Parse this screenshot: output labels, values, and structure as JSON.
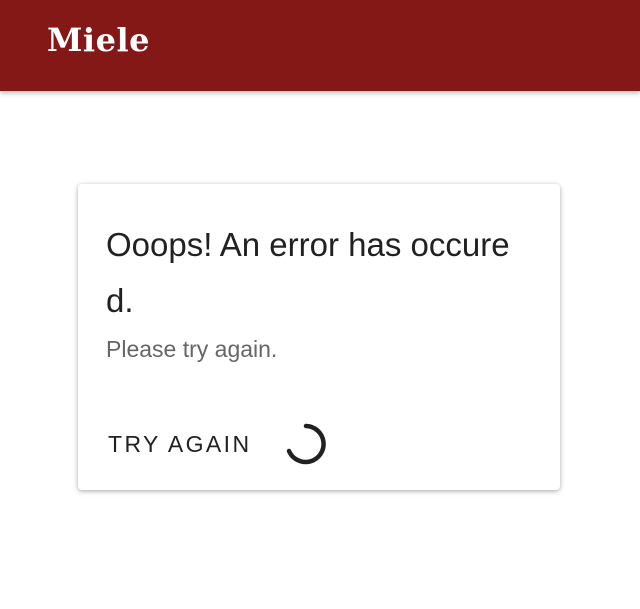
{
  "header": {
    "logo_text": "Miele",
    "background_color": "#841816"
  },
  "error_card": {
    "title": "Ooops! An error has occured.",
    "subtitle": "Please try again.",
    "action_label": "TRY AGAIN",
    "spinner_icon": "loading-spinner-icon"
  }
}
